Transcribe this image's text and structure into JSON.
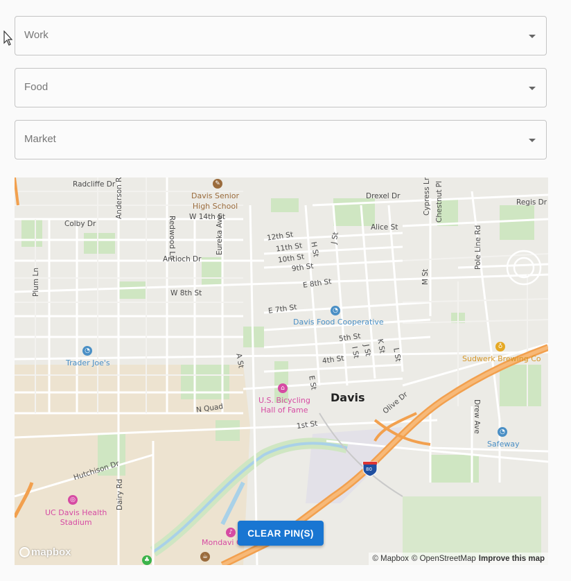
{
  "filters": [
    {
      "id": "work",
      "label": "Work"
    },
    {
      "id": "food",
      "label": "Food"
    },
    {
      "id": "market",
      "label": "Market"
    }
  ],
  "map": {
    "streets": {
      "radcliffe": "Radcliffe Dr",
      "anderson": "Anderson Rd",
      "redwood": "Redwood Ln",
      "w14th": "W 14th St",
      "drexel": "Drexel Dr",
      "cypress": "Cypress Ln",
      "chestnut": "Chestnut Pl",
      "regis": "Regis Dr",
      "colby": "Colby Dr",
      "s12th": "12th St",
      "alice": "Alice St",
      "s11th": "11th St",
      "hst": "H St",
      "jst": "J St",
      "poleline": "Pole Line Rd",
      "antioch": "Antioch Dr",
      "eureka": "Eureka Ave",
      "s10th": "10th St",
      "s9th": "9th St",
      "mst": "M St",
      "plum": "Plum Ln",
      "w8th": "W 8th St",
      "e8th": "E 8th St",
      "e7th": "E 7th St",
      "s5th": "5th St",
      "kst": "K St",
      "jst2": "J St",
      "ist": "I St",
      "lst": "L St",
      "ast": "A St",
      "s4th": "4th St",
      "est": "E St",
      "nquad": "N Quad",
      "olive": "Olive Dr",
      "s1st": "1st St",
      "drew": "Drew Ave",
      "hutchison": "Hutchison Dr",
      "dairy": "Dairy Rd",
      "i80": "80"
    },
    "pois": {
      "senior_high": "Davis Senior\nHigh School",
      "food_coop": "Davis Food Cooperative",
      "trader_joes": "Trader Joe's",
      "sudwerk": "Sudwerk Brewing Co",
      "bicycling": "U.S. Bicycling\nHall of Fame",
      "safeway": "Safeway",
      "uc_davis": "UC Davis Health\nStadium",
      "mondavi": "Mondavi C"
    },
    "city": "Davis",
    "clear_button": "CLEAR PIN(S)",
    "logo": "mapbox",
    "attribution": {
      "mapbox": "© Mapbox",
      "osm": "© OpenStreetMap",
      "improve": "Improve this map"
    },
    "colors": {
      "park": "#cfe6c2",
      "land": "#ecebe6",
      "campus": "#ede3d0",
      "road": "#ffffff",
      "highway": "#f2a04e",
      "water": "#a9d1e8",
      "button": "#1976d2"
    }
  }
}
